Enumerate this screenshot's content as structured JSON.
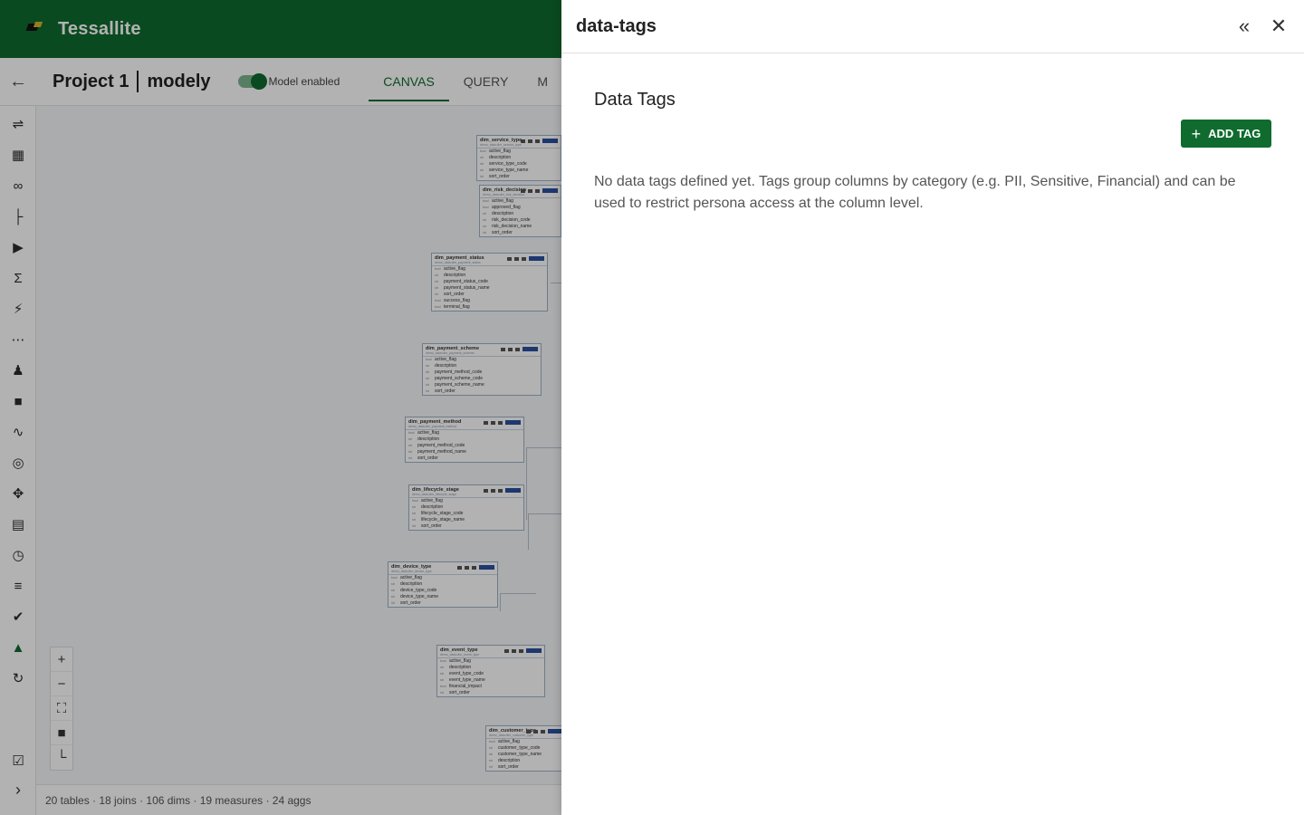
{
  "app": {
    "brand": "Tessallite"
  },
  "subheader": {
    "project": "Project 1",
    "model": "modely",
    "model_toggle_label": "Model enabled",
    "tabs": [
      {
        "label": "CANVAS",
        "active": true
      },
      {
        "label": "QUERY",
        "active": false
      },
      {
        "label": "M",
        "active": false
      }
    ]
  },
  "canvas": {
    "tables": [
      {
        "name": "dim_service_type",
        "schema": "demo_data.dim_service_type",
        "cols": [
          [
            "bool",
            "active_flag"
          ],
          [
            "str",
            "description"
          ],
          [
            "str",
            "service_type_code"
          ],
          [
            "str",
            "service_type_name"
          ],
          [
            "int",
            "sort_order"
          ]
        ]
      },
      {
        "name": "dim_risk_decision",
        "schema": "demo_data.dim_risk_decision",
        "cols": [
          [
            "bool",
            "active_flag"
          ],
          [
            "bool",
            "approved_flag"
          ],
          [
            "str",
            "description"
          ],
          [
            "str",
            "risk_decision_code"
          ],
          [
            "str",
            "risk_decision_name"
          ],
          [
            "int",
            "sort_order"
          ]
        ]
      },
      {
        "name": "dim_payment_status",
        "schema": "demo_data.dim_payment_status",
        "cols": [
          [
            "bool",
            "active_flag"
          ],
          [
            "str",
            "description"
          ],
          [
            "str",
            "payment_status_code"
          ],
          [
            "str",
            "payment_status_name"
          ],
          [
            "int",
            "sort_order"
          ],
          [
            "bool",
            "success_flag"
          ],
          [
            "bool",
            "terminal_flag"
          ]
        ]
      },
      {
        "name": "dim_payment_scheme",
        "schema": "demo_data.dim_payment_scheme",
        "cols": [
          [
            "bool",
            "active_flag"
          ],
          [
            "str",
            "description"
          ],
          [
            "str",
            "payment_method_code"
          ],
          [
            "str",
            "payment_scheme_code"
          ],
          [
            "str",
            "payment_scheme_name"
          ],
          [
            "int",
            "sort_order"
          ]
        ]
      },
      {
        "name": "dim_payment_method",
        "schema": "demo_data.dim_payment_method",
        "cols": [
          [
            "bool",
            "active_flag"
          ],
          [
            "str",
            "description"
          ],
          [
            "str",
            "payment_method_code"
          ],
          [
            "str",
            "payment_method_name"
          ],
          [
            "int",
            "sort_order"
          ]
        ]
      },
      {
        "name": "dim_lifecycle_stage",
        "schema": "demo_data.dim_lifecycle_stage",
        "cols": [
          [
            "bool",
            "active_flag"
          ],
          [
            "str",
            "description"
          ],
          [
            "str",
            "lifecycle_stage_code"
          ],
          [
            "str",
            "lifecycle_stage_name"
          ],
          [
            "int",
            "sort_order"
          ]
        ]
      },
      {
        "name": "dim_device_type",
        "schema": "demo_data.dim_device_type",
        "cols": [
          [
            "bool",
            "active_flag"
          ],
          [
            "str",
            "description"
          ],
          [
            "str",
            "device_type_code"
          ],
          [
            "str",
            "device_type_name"
          ],
          [
            "int",
            "sort_order"
          ]
        ]
      },
      {
        "name": "dim_event_type",
        "schema": "demo_data.dim_event_type",
        "cols": [
          [
            "bool",
            "active_flag"
          ],
          [
            "str",
            "description"
          ],
          [
            "str",
            "event_type_code"
          ],
          [
            "str",
            "event_type_name"
          ],
          [
            "bool",
            "financial_impact"
          ],
          [
            "int",
            "sort_order"
          ]
        ]
      },
      {
        "name": "dim_customer_type",
        "schema": "demo_data.dim_customer_type",
        "cols": [
          [
            "bool",
            "active_flag"
          ],
          [
            "str",
            "customer_type_code"
          ],
          [
            "str",
            "customer_type_name"
          ],
          [
            "str",
            "description"
          ],
          [
            "int",
            "sort_order"
          ]
        ]
      }
    ],
    "zoom_controls": {
      "zoom_in": "+",
      "zoom_out": "−"
    },
    "status": "20 tables · 18 joins · 106 dims · 19 measures · 24 aggs"
  },
  "drawer": {
    "title": "data-tags",
    "section_title": "Data Tags",
    "add_button_label": "ADD TAG",
    "empty_message": "No data tags defined yet. Tags group columns by category (e.g. PII, Sensitive, Financial) and can be used to restrict persona access at the column level."
  },
  "icons": {
    "rail": [
      "model-icon",
      "table-icon",
      "link-icon",
      "hierarchy-icon",
      "tag-icon",
      "sigma-icon",
      "bolt-icon",
      "grid-dots-icon",
      "people-icon",
      "lock-icon",
      "trend-icon",
      "target-icon",
      "move-icon",
      "book-icon",
      "clock-icon",
      "tune-icon",
      "verified-icon",
      "logo-mark-icon",
      "sync-icon",
      "checklist-icon"
    ]
  },
  "colors": {
    "brand_green": "#0f6b2e",
    "accent_blue": "#2a4fa0"
  }
}
